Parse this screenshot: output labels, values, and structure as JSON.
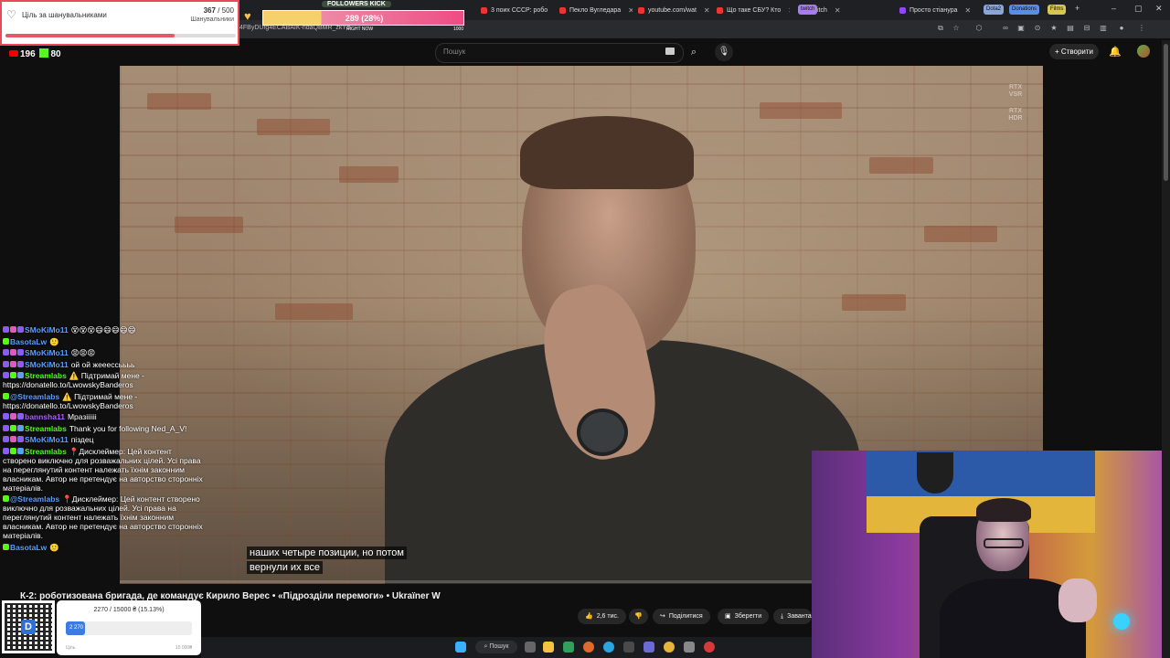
{
  "browser": {
    "tabs": [
      {
        "title": "3 поих СССР: робо",
        "color": "#e33"
      },
      {
        "title": "Пекло Вугледара",
        "color": "#e33"
      },
      {
        "title": "youtube.com/wat",
        "color": "#e33"
      },
      {
        "title": "Що таке СБУ? Кто",
        "color": "#e33"
      },
      {
        "title": "Twitch",
        "color": "#9146ff"
      },
      {
        "title": "Просто стіанура",
        "color": "#9146ff"
      }
    ],
    "chips": [
      {
        "label": "twitch",
        "color": "#a77bf3"
      },
      {
        "label": "Dota2",
        "color": "#8aa6d8"
      },
      {
        "label": "Donations",
        "color": "#5b8de8"
      },
      {
        "label": "Films",
        "color": "#d6c750"
      }
    ],
    "url": "4FByDUfg4ECABAIK-ndaQBMR_zkYd"
  },
  "youtube": {
    "search_placeholder": "Пошук",
    "create_label": "Створити",
    "video_title": "К-2: роботизована бригада, де командує Кирило Верес • «Підрозділи перемоги» • Ukraїner W",
    "subtitle_line1": "наших четыре позиции, но потом",
    "subtitle_line2": "вернули их все",
    "likes": "2,6 тис.",
    "share_label": "Поділитися",
    "save_label": "Зберегти",
    "download_label": "Завантаж",
    "rtx_label": "RTX VSR",
    "hdr_label": "RTX HDR",
    "progress": 0.0
  },
  "goal_widget": {
    "title": "Ціль за шанувальниками",
    "current": "367",
    "max": "500",
    "separator": " / ",
    "label": "Шанувальники",
    "progress": 0.734
  },
  "followers_kick": {
    "title": "FOLLOWERS KICK",
    "value": "289 (28%)",
    "status": "RIGHT NOW",
    "max": "1000",
    "progress": 0.289
  },
  "stream_stats": {
    "viewers_youtube": "196",
    "viewers_kick": "80"
  },
  "chat": [
    {
      "badges": [
        "#8a5cf6",
        "#e05ac0",
        "#8a5cf6"
      ],
      "user": "SMoKiMo11",
      "user_color": "#5c9ef6",
      "text": "😵😵😵😄😄😄😄😄"
    },
    {
      "badges": [
        "#53fc18"
      ],
      "user": "BasotaLw",
      "user_color": "#5c9ef6",
      "text": "🙂"
    },
    {
      "badges": [
        "#8a5cf6",
        "#e05ac0",
        "#8a5cf6"
      ],
      "user": "SMoKiMo11",
      "user_color": "#5c9ef6",
      "text": "😡😡😡"
    },
    {
      "badges": [
        "#8a5cf6",
        "#e05ac0",
        "#8a5cf6"
      ],
      "user": "SMoKiMo11",
      "user_color": "#5c9ef6",
      "text": "ой ой жееессьььь"
    },
    {
      "badges": [
        "#8a5cf6",
        "#53fc18",
        "#5c9ef6"
      ],
      "user": "Streamlabs",
      "user_color": "#53fc18",
      "text": "⚠️ Підтримай мене - https://donatello.to/LwowskyBanderos"
    },
    {
      "badges": [
        "#53fc18"
      ],
      "user": "@Streamlabs",
      "user_color": "#5c9ef6",
      "text": "⚠️ Підтримай мене - https://donatello.to/LwowskyBanderos"
    },
    {
      "badges": [
        "#8a5cf6",
        "#e05ac0",
        "#8a5cf6"
      ],
      "user": "bannsha11",
      "user_color": "#b05cf6",
      "text": "Мразіііііі"
    },
    {
      "badges": [
        "#8a5cf6",
        "#53fc18",
        "#5c9ef6"
      ],
      "user": "Streamlabs",
      "user_color": "#53fc18",
      "text": "Thank you for following Ned_A_V!"
    },
    {
      "badges": [
        "#8a5cf6",
        "#e05ac0",
        "#8a5cf6"
      ],
      "user": "SMoKiMo11",
      "user_color": "#5c9ef6",
      "text": "піздец"
    },
    {
      "badges": [
        "#8a5cf6",
        "#53fc18",
        "#5c9ef6"
      ],
      "user": "Streamlabs",
      "user_color": "#53fc18",
      "text": "📍Дисклеймер: Цей контент створено виключно для розважальних цілей. Усі права на переглянутий контент належать їхнім законним власникам. Автор не претендує на авторство сторонніх матеріалів."
    },
    {
      "badges": [
        "#53fc18"
      ],
      "user": "@Streamlabs",
      "user_color": "#5c9ef6",
      "text": "📍Дисклеймер: Цей контент створено виключно для розважальних цілей. Усі права на переглянутий контент належать їхнім законним власникам. Автор не претендує на авторство сторонніх матеріалів."
    },
    {
      "badges": [
        "#53fc18"
      ],
      "user": "BasotaLw",
      "user_color": "#5c9ef6",
      "text": "🙂"
    }
  ],
  "donation_goal": {
    "text": "2270 / 15000 ₴ (15.13%)",
    "current": "2 270",
    "label": "Ціль",
    "max": "15 000₴",
    "progress": 0.1513
  },
  "taskbar": {
    "search_label": "Пошук"
  }
}
